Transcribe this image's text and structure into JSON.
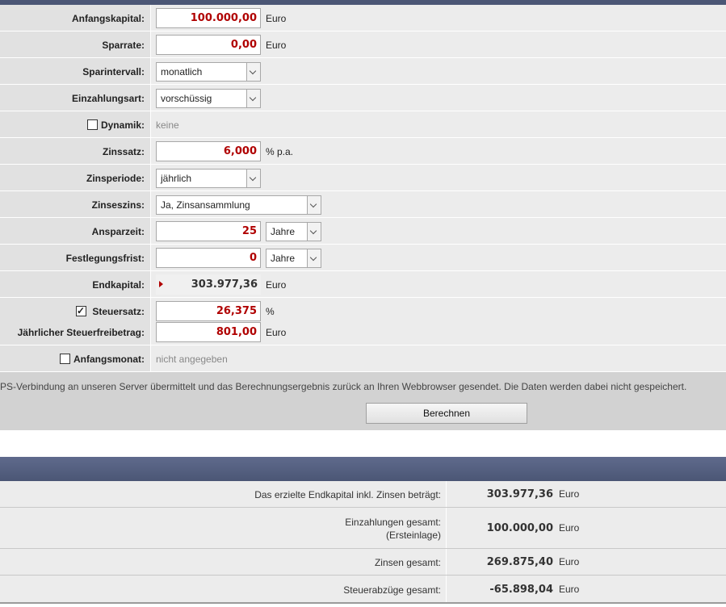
{
  "form": {
    "anfangskapital": {
      "label": "Anfangskapital:",
      "value": "100.000,00",
      "unit": "Euro"
    },
    "sparrate": {
      "label": "Sparrate:",
      "value": "0,00",
      "unit": "Euro"
    },
    "sparintervall": {
      "label": "Sparintervall:",
      "selected": "monatlich"
    },
    "einzahlungsart": {
      "label": "Einzahlungsart:",
      "selected": "vorschüssig"
    },
    "dynamik": {
      "label": "Dynamik:",
      "checked": false,
      "status": "keine"
    },
    "zinssatz": {
      "label": "Zinssatz:",
      "value": "6,000",
      "unit": "% p.a."
    },
    "zinsperiode": {
      "label": "Zinsperiode:",
      "selected": "jährlich"
    },
    "zinseszins": {
      "label": "Zinseszins:",
      "selected": "Ja, Zinsansammlung"
    },
    "ansparzeit": {
      "label": "Ansparzeit:",
      "value": "25",
      "unit_selected": "Jahre"
    },
    "festlegungsfrist": {
      "label": "Festlegungsfrist:",
      "value": "0",
      "unit_selected": "Jahre"
    },
    "endkapital": {
      "label": "Endkapital:",
      "value": "303.977,36",
      "unit": "Euro"
    },
    "steuersatz": {
      "label": "Steuersatz:",
      "checked": true,
      "value": "26,375",
      "unit": "%"
    },
    "steuerfreibetrag": {
      "label": "Jährlicher Steuerfreibetrag:",
      "value": "801,00",
      "unit": "Euro"
    },
    "anfangsmonat": {
      "label": "Anfangsmonat:",
      "checked": false,
      "status": "nicht angegeben"
    }
  },
  "notice": {
    "text": "PS-Verbindung an unseren Server übermittelt und das Berechnungsergebnis zurück an Ihren Webbrowser gesendet. Die Daten werden dabei nicht gespeichert."
  },
  "submit_label": "Berechnen",
  "results": [
    {
      "label": "Das erzielte Endkapital inkl. Zinsen beträgt:",
      "value": "303.977,36",
      "unit": "Euro"
    },
    {
      "label": "Einzahlungen gesamt:",
      "sublabel": "(Ersteinlage)",
      "value": "100.000,00",
      "unit": "Euro"
    },
    {
      "label": "Zinsen gesamt:",
      "value": "269.875,40",
      "unit": "Euro"
    },
    {
      "label": "Steuerabzüge gesamt:",
      "value": "-65.898,04",
      "unit": "Euro"
    }
  ],
  "colors": {
    "accent_red": "#b00000",
    "header_bar": "#4b5675",
    "row_bg": "#ececec",
    "label_bg": "#e1e1e1"
  }
}
